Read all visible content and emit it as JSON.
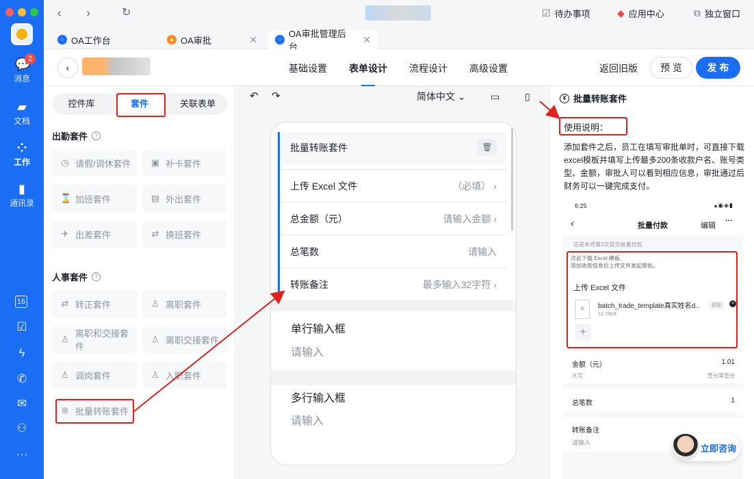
{
  "sidebar": {
    "badge_count": "2",
    "items": [
      {
        "label": "消息",
        "icon": "chat-icon"
      },
      {
        "label": "文档",
        "icon": "folder-icon"
      },
      {
        "label": "工作",
        "icon": "grid-icon"
      },
      {
        "label": "通讯录",
        "icon": "contacts-icon"
      }
    ],
    "bottom_icons": [
      "calendar-icon",
      "check-icon",
      "bolt-icon",
      "phone-icon",
      "mail-icon",
      "people-icon",
      "more-icon"
    ],
    "calendar_day": "16"
  },
  "topbar": {
    "todo": "待办事项",
    "app_center": "应用中心",
    "standalone": "独立窗口"
  },
  "tabs": [
    {
      "label": "OA工作台"
    },
    {
      "label": "OA审批"
    },
    {
      "label": "OA审批管理后台"
    }
  ],
  "header": {
    "tabs": [
      "基础设置",
      "表单设计",
      "流程设计",
      "高级设置"
    ],
    "active_tab": "表单设计",
    "back_old": "返回旧版",
    "preview": "预 览",
    "publish": "发 布"
  },
  "left_panel": {
    "segments": [
      "控件库",
      "套件",
      "关联表单"
    ],
    "active_segment": "套件",
    "sections": [
      {
        "title": "出勤套件",
        "items": [
          {
            "label": "请假/调休套件",
            "icon": "clock-icon"
          },
          {
            "label": "补卡套件",
            "icon": "calendar-check-icon"
          },
          {
            "label": "加班套件",
            "icon": "overtime-icon"
          },
          {
            "label": "外出套件",
            "icon": "briefcase-icon"
          },
          {
            "label": "出差套件",
            "icon": "plane-icon"
          },
          {
            "label": "换班套件",
            "icon": "swap-icon"
          }
        ]
      },
      {
        "title": "人事套件",
        "items": [
          {
            "label": "转正套件",
            "icon": "swap-icon"
          },
          {
            "label": "离职套件",
            "icon": "user-leave-icon"
          },
          {
            "label": "离职和交接套件",
            "icon": "user-icon"
          },
          {
            "label": "离职交接套件",
            "icon": "user-icon"
          },
          {
            "label": "调岗套件",
            "icon": "user-icon"
          },
          {
            "label": "入职套件",
            "icon": "user-icon"
          },
          {
            "label": "批量转账套件",
            "icon": "transfer-icon"
          }
        ]
      }
    ]
  },
  "canvas": {
    "language": "简体中文",
    "suite": {
      "title": "批量转账套件",
      "rows": [
        {
          "label": "上传 Excel 文件",
          "value": "（必填）"
        },
        {
          "label": "总金额（元）",
          "value": "请输入金额"
        },
        {
          "label": "总笔数",
          "value": "请输入"
        },
        {
          "label": "转账备注",
          "value": "最多输入32字符"
        }
      ]
    },
    "fields": [
      {
        "title": "单行输入框",
        "placeholder": "请输入"
      },
      {
        "title": "多行输入框",
        "placeholder": "请输入"
      }
    ]
  },
  "right_panel": {
    "title": "批量转账套件",
    "usage_title": "使用说明：",
    "description": "添加套件之后，员工在填写审批单时，可直接下载excel模板并填写上传最多200条收款户名、账号类型、金额，审批人可以看到相应信息，审批通过后财务可以一键完成支付。",
    "preview": {
      "time": "6:25",
      "nav_title": "批量付款",
      "nav_edit": "编辑",
      "tip": "这是本月第3次提交批量付款",
      "hint_line1": "点此下载 Excel 模板,",
      "hint_line2": "添加收款信息后上传文件发起审批。",
      "upload_label": "上传 Excel 文件",
      "file_name": "batch_trade_template真实姓名d..",
      "file_size": "13.75KB",
      "preview_tag": "预览",
      "amount_label": "金额（元）",
      "amount_value": "1.01",
      "uppercase_label": "大写",
      "uppercase_value": "壹元零壹分",
      "count_label": "总笔数",
      "count_value": "1",
      "remark_label": "转账备注",
      "remark_placeholder": "请输入"
    },
    "consult": "立即咨询"
  }
}
